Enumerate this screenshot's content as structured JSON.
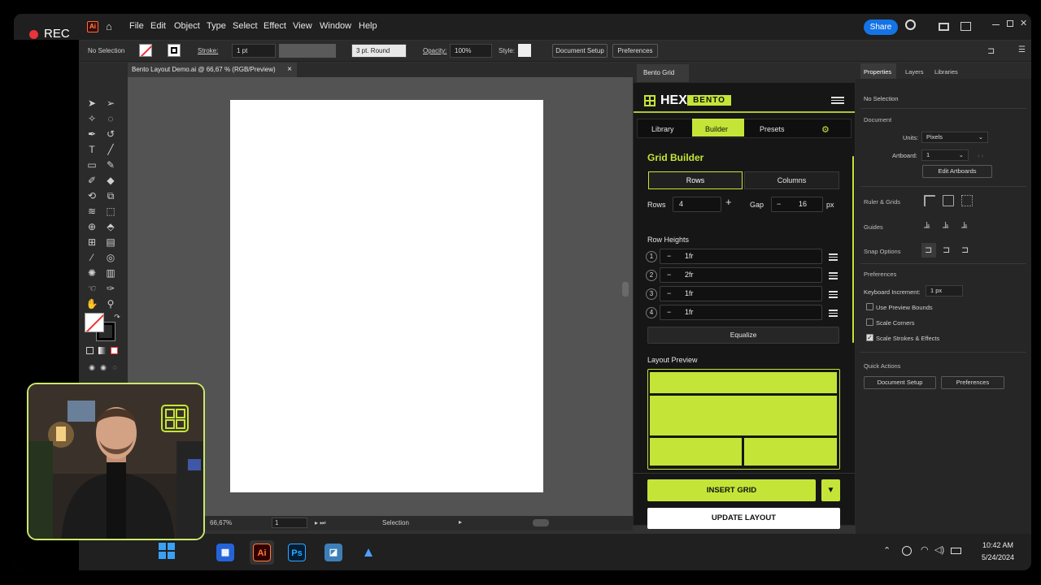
{
  "recording": {
    "label": "REC"
  },
  "menubar": {
    "app_badge": "Ai",
    "items": [
      "File",
      "Edit",
      "Object",
      "Type",
      "Select",
      "Effect",
      "View",
      "Window",
      "Help"
    ],
    "share_label": "Share"
  },
  "controlbar": {
    "selection": "No Selection",
    "stroke_label": "Stroke:",
    "stroke_value": "1 pt",
    "brush_value": "3 pt. Round",
    "opacity_label": "Opacity:",
    "opacity_value": "100%",
    "style_label": "Style:",
    "document_setup": "Document Setup",
    "preferences": "Preferences"
  },
  "document": {
    "tab_title": "Bento Layout Demo.ai @ 66,67 % (RGB/Preview)",
    "close": "×"
  },
  "statusbar": {
    "zoom": "66,67%",
    "page": "1",
    "tool": "Selection"
  },
  "plugin": {
    "tab_title": "Bento Grid",
    "logo_hex": "HEX",
    "logo_bento": "BENTO",
    "tabs": [
      "Library",
      "Builder",
      "Presets"
    ],
    "active_tab": "Builder",
    "section_title": "Grid Builder",
    "mode_buttons": [
      "Rows",
      "Columns"
    ],
    "active_mode": "Rows",
    "rows_label": "Rows",
    "rows_value": "4",
    "gap_label": "Gap",
    "gap_value": "16",
    "gap_unit": "px",
    "row_heights_label": "Row Heights",
    "row_heights": [
      {
        "index": "1",
        "value": "1fr"
      },
      {
        "index": "2",
        "value": "2fr"
      },
      {
        "index": "3",
        "value": "1fr"
      },
      {
        "index": "4",
        "value": "1fr"
      }
    ],
    "minus": "−",
    "plus": "+",
    "equalize_label": "Equalize",
    "preview_label": "Layout Preview",
    "insert_label": "INSERT GRID",
    "update_label": "UPDATE LAYOUT",
    "accent_color": "#c4e538"
  },
  "properties": {
    "tabs": [
      "Properties",
      "Layers",
      "Libraries"
    ],
    "no_selection": "No Selection",
    "document_head": "Document",
    "units_label": "Units:",
    "units_value": "Pixels",
    "artboard_label": "Artboard:",
    "artboard_value": "1",
    "edit_artboards": "Edit Artboards",
    "ruler_grids": "Ruler & Grids",
    "guides": "Guides",
    "snap_options": "Snap Options",
    "preferences_head": "Preferences",
    "keyboard_increment_label": "Keyboard Increment:",
    "keyboard_increment_value": "1 px",
    "checks": [
      {
        "label": "Use Preview Bounds",
        "checked": false
      },
      {
        "label": "Scale Corners",
        "checked": false
      },
      {
        "label": "Scale Strokes & Effects",
        "checked": true
      }
    ],
    "quick_actions": "Quick Actions",
    "qa_document_setup": "Document Setup",
    "qa_preferences": "Preferences"
  },
  "taskbar": {
    "apps": [
      "Ai",
      "Ps"
    ],
    "time": "10:42 AM",
    "date": "5/24/2024"
  }
}
